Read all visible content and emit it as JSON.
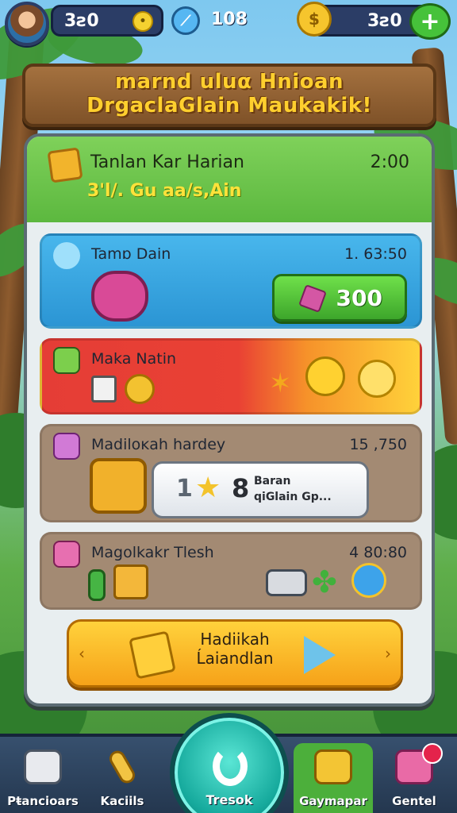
{
  "topbar": {
    "player_coins": "3ƨ0",
    "energy": "108",
    "gold": "3ƨ0"
  },
  "title_sign": {
    "line1": "marnd uluα Hnioan",
    "line2": "DrgaclaGlain Maukakik!"
  },
  "panel": {
    "title": "Tanlan Kar Harian",
    "subtitle": "3'l/. Gu aa/s,Ain",
    "time": "2:00"
  },
  "cards": [
    {
      "title": "Tamɒ Dain",
      "value": "1. 63:50",
      "button_value": "300"
    },
    {
      "title": "Maka Natin"
    },
    {
      "title": "Madiloĸah  hardey",
      "value": "15 ,750",
      "reward_number": "8",
      "reward_text_1": "Baran",
      "reward_text_2": "qiGlain Gp..."
    },
    {
      "title": "Magolkakr Tlesh",
      "value": "4 80:80"
    }
  ],
  "claim_button": {
    "line1": "Hadiikah",
    "line2": "Ĺaiandlan"
  },
  "nav": {
    "items": [
      {
        "label": "Pŧancioars"
      },
      {
        "label": "Kaciils"
      },
      {
        "label": "Tresok"
      },
      {
        "label": "Gaymapar"
      },
      {
        "label": "Gentel"
      }
    ]
  },
  "colors": {
    "panel_head": "#5cb83f",
    "card_blue": "#2b95d4",
    "card_red": "#e53d36",
    "card_brown": "#a38a73",
    "claim_gold": "#f6a219",
    "nav_bg": "#24374f"
  }
}
